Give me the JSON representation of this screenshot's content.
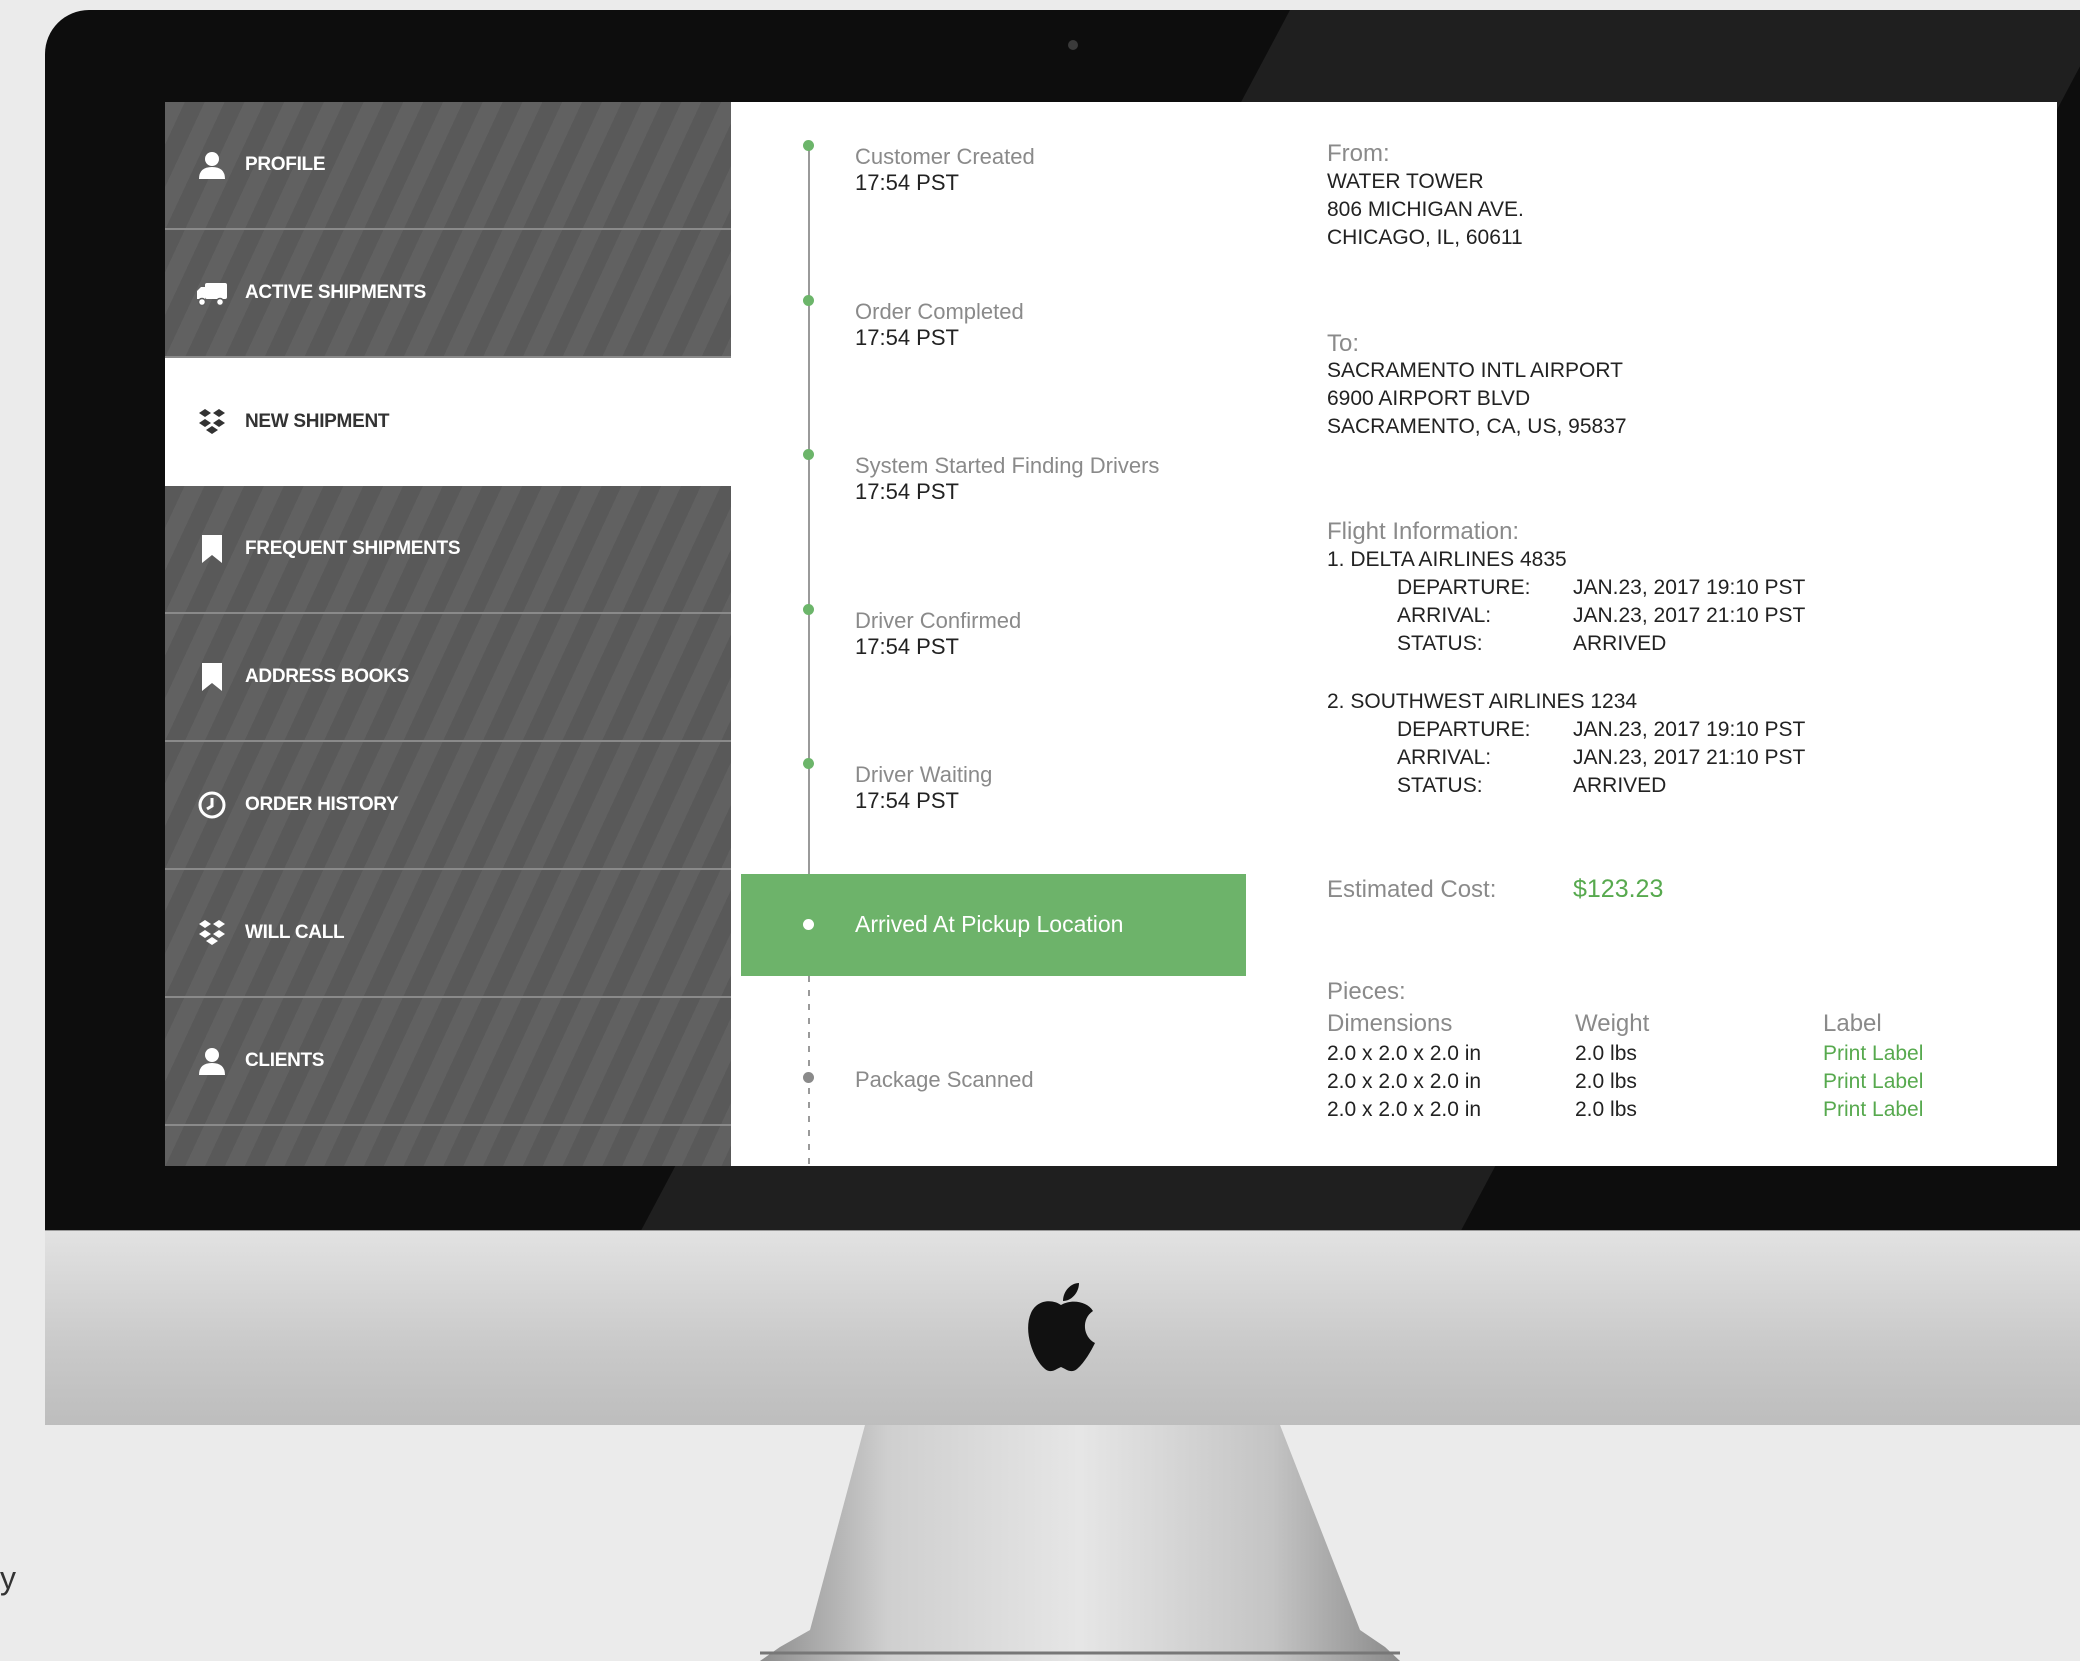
{
  "sidebar": {
    "items": [
      {
        "label": "PROFILE",
        "icon": "user-icon"
      },
      {
        "label": "ACTIVE SHIPMENTS",
        "icon": "truck-icon"
      },
      {
        "label": "NEW SHIPMENT",
        "icon": "boxes-icon",
        "active": true
      },
      {
        "label": "FREQUENT SHIPMENTS",
        "icon": "bookmark-icon"
      },
      {
        "label": "ADDRESS BOOKS",
        "icon": "bookmark-icon"
      },
      {
        "label": "ORDER HISTORY",
        "icon": "clock-icon"
      },
      {
        "label": "WILL CALL",
        "icon": "boxes-icon"
      },
      {
        "label": "CLIENTS",
        "icon": "user-icon"
      }
    ]
  },
  "timeline": {
    "steps": [
      {
        "label": "Customer Created",
        "time": "17:54 PST"
      },
      {
        "label": "Order Completed",
        "time": "17:54 PST"
      },
      {
        "label": "System Started Finding Drivers",
        "time": "17:54 PST"
      },
      {
        "label": "Driver Confirmed",
        "time": "17:54 PST"
      },
      {
        "label": "Driver Waiting",
        "time": "17:54 PST"
      },
      {
        "label": "Arrived At Pickup Location",
        "time": ""
      },
      {
        "label": "Package Scanned",
        "time": ""
      }
    ],
    "active_step": "Arrived At Pickup Location"
  },
  "details": {
    "from": {
      "heading": "From:",
      "lines": [
        "WATER TOWER",
        "806 MICHIGAN AVE.",
        "CHICAGO, IL, 60611"
      ]
    },
    "to": {
      "heading": "To:",
      "lines": [
        "SACRAMENTO INTL AIRPORT",
        "6900 AIRPORT BLVD",
        "SACRAMENTO, CA, US, 95837"
      ]
    },
    "flight": {
      "heading": "Flight Information:",
      "flights": [
        {
          "title": "1. DELTA AIRLINES 4835",
          "departure_label": "DEPARTURE:",
          "departure": "JAN.23, 2017 19:10 PST",
          "arrival_label": "ARRIVAL:",
          "arrival": "JAN.23, 2017 21:10 PST",
          "status_label": "STATUS:",
          "status": "ARRIVED"
        },
        {
          "title": "2. SOUTHWEST AIRLINES 1234",
          "departure_label": "DEPARTURE:",
          "departure": "JAN.23, 2017 19:10 PST",
          "arrival_label": "ARRIVAL:",
          "arrival": "JAN.23, 2017 21:10 PST",
          "status_label": "STATUS:",
          "status": "ARRIVED"
        }
      ]
    },
    "cost": {
      "label": "Estimated Cost:",
      "value": "$123.23"
    },
    "pieces": {
      "heading": "Pieces:",
      "columns": [
        "Dimensions",
        "Weight",
        "Label"
      ],
      "rows": [
        {
          "dimensions": "2.0 x 2.0 x 2.0 in",
          "weight": "2.0 lbs",
          "label": "Print Label"
        },
        {
          "dimensions": "2.0 x 2.0 x 2.0 in",
          "weight": "2.0 lbs",
          "label": "Print Label"
        },
        {
          "dimensions": "2.0 x 2.0 x 2.0 in",
          "weight": "2.0 lbs",
          "label": "Print Label"
        }
      ]
    }
  },
  "page": {
    "side_text": "y"
  },
  "colors": {
    "accent": "#6db36a",
    "sidebar": "#5c5c5c"
  }
}
